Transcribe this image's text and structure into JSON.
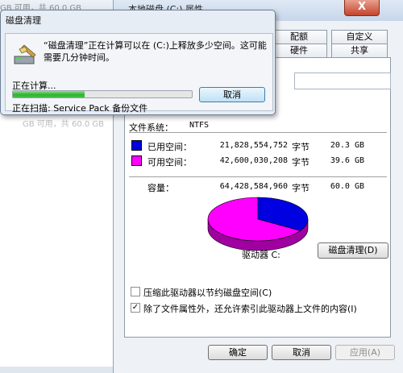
{
  "background": {
    "drive_text": "GB 可用，共 60.0 GB",
    "left_text": "GB 可用，共 60.0 GB"
  },
  "properties": {
    "title": "本地磁盘 (C:) 属性",
    "close_glyph": "X",
    "tabs": [
      "配额",
      "自定义",
      "硬件",
      "共享"
    ],
    "filesystem_label": "文件系统：",
    "filesystem_value": "NTFS",
    "used": {
      "label": "已用空间：",
      "bytes": "21,828,554,752",
      "unit": "字节",
      "gb": "20.3 GB",
      "color": "#0000e0"
    },
    "free": {
      "label": "可用空间：",
      "bytes": "42,600,030,208",
      "unit": "字节",
      "gb": "39.6 GB",
      "color": "#ff00ff"
    },
    "capacity": {
      "label": "容量：",
      "bytes": "64,428,584,960",
      "unit": "字节",
      "gb": "60.0 GB"
    },
    "used_fraction": 0.339,
    "drive_label": "驱动器 C:",
    "cleanup_button": "磁盘清理(D)",
    "compress_label": "压缩此驱动器以节约磁盘空间(C)",
    "compress_checked": false,
    "index_label": "除了文件属性外，还允许索引此驱动器上文件的内容(I)",
    "index_checked": true,
    "ok": "确定",
    "cancel": "取消",
    "apply": "应用(A)"
  },
  "cleanup_dialog": {
    "title": "磁盘清理",
    "message": "“磁盘清理”正在计算可以在 (C:)上释放多少空间。这可能需要几分钟时间。",
    "status": "正在计算...",
    "progress": 0.4,
    "cancel": "取消",
    "scanning": "正在扫描: Service Pack 备份文件"
  }
}
